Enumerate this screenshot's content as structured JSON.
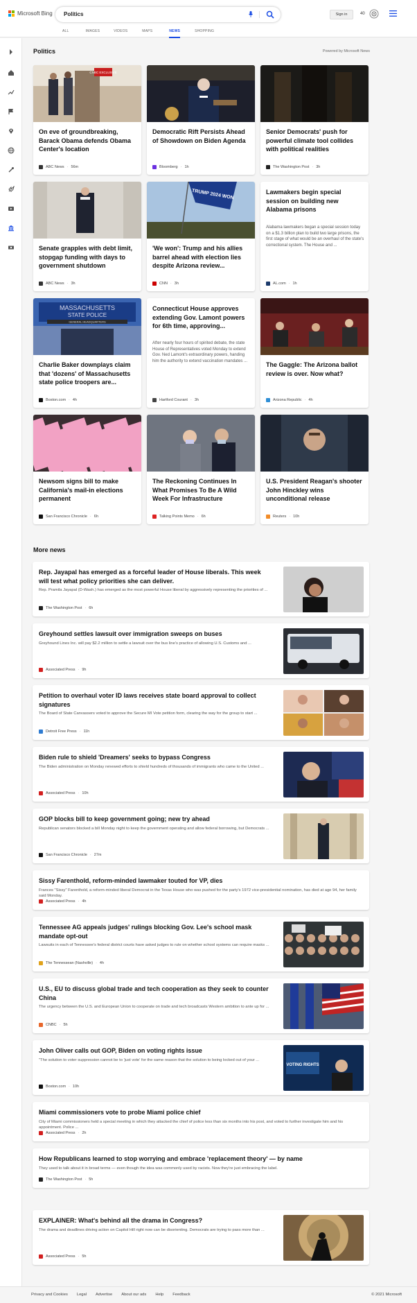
{
  "header": {
    "brand": "Microsoft Bing",
    "query": "Politics",
    "signin": "Sign in",
    "points": "40",
    "tabs": [
      "ALL",
      "IMAGES",
      "VIDEOS",
      "MAPS",
      "NEWS",
      "SHOPPING"
    ],
    "active_tab": "NEWS"
  },
  "section": {
    "title": "Politics",
    "powered": "Powered by Microsoft News"
  },
  "cards": [
    {
      "headline": "On eve of groundbreaking, Barack Obama defends Obama Center's location",
      "source": "ABC News",
      "time": "56m",
      "logo_color": "#333",
      "badge": "CNBC EXCLUSIVE"
    },
    {
      "headline": "Democratic Rift Persists Ahead of Showdown on Biden Agenda",
      "source": "Bloomberg",
      "time": "1h",
      "logo_color": "#6b2fe0"
    },
    {
      "headline": "Senior Democrats' push for powerful climate tool collides with political realities",
      "source": "The Washington Post",
      "time": "3h",
      "logo_color": "#222"
    },
    {
      "headline": "Senate grapples with debt limit, stopgap funding with days to government shutdown",
      "source": "ABC News",
      "time": "3h",
      "logo_color": "#333"
    },
    {
      "headline": "'We won': Trump and his allies barrel ahead with election lies despite Arizona review...",
      "source": "CNN",
      "time": "3h",
      "logo_color": "#cc0000",
      "flag_text": "TRUMP 2024 WON"
    },
    {
      "headline": "Lawmakers begin special session on building new Alabama prisons",
      "snippet": "Alabama lawmakers began a special session today on a $1.3 billion plan to build two large prisons, the first stage of what would be an overhaul of the state's correctional system. The House and ...",
      "source": "AL.com",
      "time": "1h",
      "logo_color": "#1b3a6b"
    },
    {
      "headline": "Charlie Baker downplays claim that 'dozens' of Massachusetts state police troopers are...",
      "source": "Boston.com",
      "time": "4h",
      "logo_color": "#111",
      "sign_line1": "MASSACHUSETTS",
      "sign_line2": "STATE POLICE",
      "sign_line3": "GENERAL HEADQUARTERS"
    },
    {
      "headline": "Connecticut House approves extending Gov. Lamont powers for 6th time, approving...",
      "snippet": "After nearly four hours of spirited debate, the state House of Representatives voted Monday to extend Gov. Ned Lamont's extraordinary powers, handing him the authority to extend vaccination mandates ...",
      "source": "Hartford Courant",
      "time": "3h",
      "logo_color": "#444"
    },
    {
      "headline": "The Gaggle: The Arizona ballot review is over. Now what?",
      "source": "Arizona Republic",
      "time": "4h",
      "logo_color": "#2f8fd6"
    },
    {
      "headline": "Newsom signs bill to make California's mail-in elections permanent",
      "source": "San Francisco Chronicle",
      "time": "6h",
      "logo_color": "#111"
    },
    {
      "headline": "The Reckoning Continues In What Promises To Be A Wild Week For Infrastructure",
      "source": "Talking Points Memo",
      "time": "6h",
      "logo_color": "#d22"
    },
    {
      "headline": "U.S. President Reagan's shooter John Hinckley wins unconditional release",
      "source": "Reuters",
      "time": "10h",
      "logo_color": "#f28c28"
    }
  ],
  "more": {
    "title": "More news",
    "items": [
      {
        "title": "Rep. Jayapal has emerged as a forceful leader of House liberals. This week will test what policy priorities she can deliver.",
        "snippet": "Rep. Pramila Jayapal (D-Wash.) has emerged as the most powerful House liberal by aggressively representing the priorities of ...",
        "source": "The Washington Post",
        "time": "6h",
        "logo_color": "#222"
      },
      {
        "title": "Greyhound settles lawsuit over immigration sweeps on buses",
        "snippet": "Greyhound Lines Inc. will pay $2.2 million to settle a lawsuit over the bus line's practice of allowing U.S. Customs and ...",
        "source": "Associated Press",
        "time": "9h",
        "logo_color": "#d21f1f"
      },
      {
        "title": "Petition to overhaul voter ID laws receives state board approval to collect signatures",
        "snippet": "The Board of State Canvassers voted to approve the Secure MI Vote petition form, clearing the way for the group to start ...",
        "source": "Detroit Free Press",
        "time": "11h",
        "logo_color": "#2e7bd1"
      },
      {
        "title": "Biden rule to shield 'Dreamers' seeks to bypass Congress",
        "snippet": "The Biden administration on Monday renewed efforts to shield hundreds of thousands of immigrants who came to the United ...",
        "source": "Associated Press",
        "time": "10h",
        "logo_color": "#d21f1f"
      },
      {
        "title": "GOP blocks bill to keep government going; new try ahead",
        "snippet": "Republican senators blocked a bill Monday night to keep the government operating and allow federal borrowing, but Democrats ...",
        "source": "San Francisco Chronicle",
        "time": "27m",
        "logo_color": "#111"
      },
      {
        "title": "Sissy Farenthold, reform-minded lawmaker touted for VP, dies",
        "snippet": "Frances \"Sissy\" Farenthold, a reform-minded liberal Democrat in the Texas House who was pushed for the party's 1972 vice-presidential nomination, has died at age 94, her family said Monday.",
        "source": "Associated Press",
        "time": "4h",
        "logo_color": "#d21f1f"
      },
      {
        "title": "Tennessee AG appeals judges' rulings blocking Gov. Lee's school mask mandate opt-out",
        "snippet": "Lawsuits in each of Tennessee's federal district courts have asked judges to rule on whether school systems can require masks ...",
        "source": "The Tennessean (Nashville)",
        "time": "4h",
        "logo_color": "#e0a21b"
      },
      {
        "title": "U.S., EU to discuss global trade and tech cooperation as they seek to counter China",
        "snippet": "The urgency between the U.S. and European Union to cooperate on trade and tech broadcasts Western ambition to ante up for ...",
        "source": "CNBC",
        "time": "5h",
        "logo_color": "#e8672b"
      },
      {
        "title": "John Oliver calls out GOP, Biden on voting rights issue",
        "snippet": "\"The solution to voter suppression cannot be to 'just vote' for the same reason that the solution to being locked out of your ...",
        "source": "Boston.com",
        "time": "10h",
        "logo_color": "#111",
        "screen_text": "VOTING RIGHTS"
      },
      {
        "title": "Miami commissioners vote to probe Miami police chief",
        "snippet": "City of Miami commissioners held a special meeting in which they attacked the chief of police less than six months into his post, and voted to further investigate him and his appointment. Police ...",
        "source": "Associated Press",
        "time": "2h",
        "logo_color": "#d21f1f"
      },
      {
        "title": "How Republicans learned to stop worrying and embrace 'replacement theory' — by name",
        "snippet": "They used to talk about it in broad terms — even though the idea was commonly used by racists. Now they're just embracing the label.",
        "source": "The Washington Post",
        "time": "5h",
        "logo_color": "#222"
      },
      {
        "title": "EXPLAINER: What's behind all the drama in Congress?",
        "snippet": "The drama and deadlines driving action on Capitol Hill right now can be disorienting. Democrats are trying to pass more than ...",
        "source": "Associated Press",
        "time": "5h",
        "logo_color": "#d21f1f"
      }
    ]
  },
  "footer": {
    "links": [
      "Privacy and Cookies",
      "Legal",
      "Advertise",
      "About our ads",
      "Help",
      "Feedback"
    ],
    "copyright": "© 2021 Microsoft"
  },
  "colors": {
    "accent": "#174ae4",
    "ms_red": "#f25022",
    "ms_green": "#7fba00",
    "ms_blue": "#00a4ef",
    "ms_yellow": "#ffb900"
  }
}
